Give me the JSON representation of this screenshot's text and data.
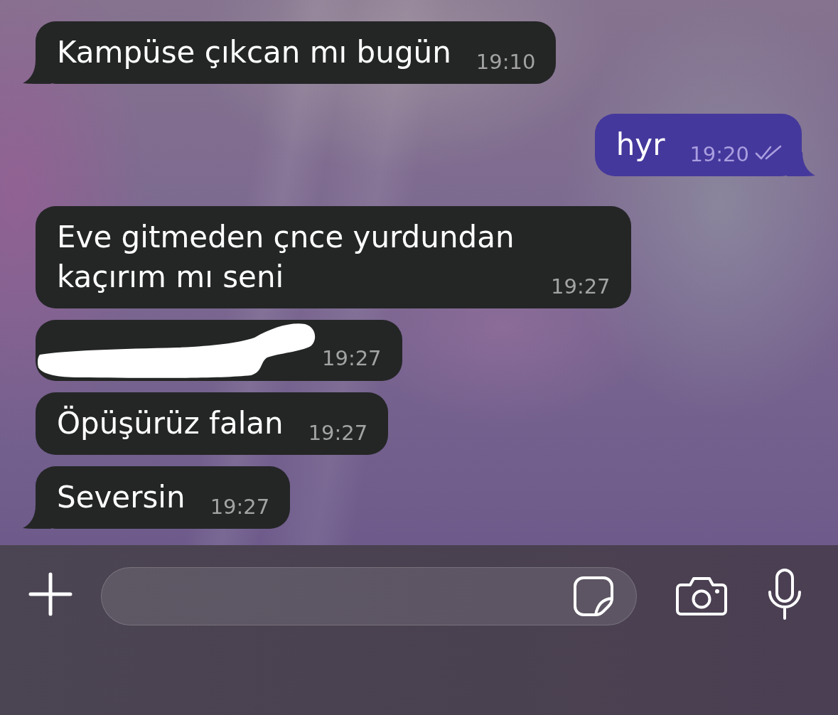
{
  "messages": [
    {
      "kind": "text",
      "outgoing": false,
      "tail": true,
      "text": "Kampüse çıkcan mı bugün",
      "time": "19:10"
    },
    {
      "kind": "text",
      "outgoing": true,
      "tail": true,
      "text": "hyr",
      "time": "19:20",
      "read": true
    },
    {
      "kind": "text",
      "outgoing": false,
      "tail": false,
      "text": "Eve gitmeden çnce yurdundan kaçırım mı seni",
      "time": "19:27"
    },
    {
      "kind": "redacted",
      "outgoing": false,
      "tail": false,
      "time": "19:27"
    },
    {
      "kind": "text",
      "outgoing": false,
      "tail": false,
      "text": "Öpüşürüz falan",
      "time": "19:27"
    },
    {
      "kind": "text",
      "outgoing": false,
      "tail": true,
      "text": "Seversin",
      "time": "19:27"
    }
  ]
}
